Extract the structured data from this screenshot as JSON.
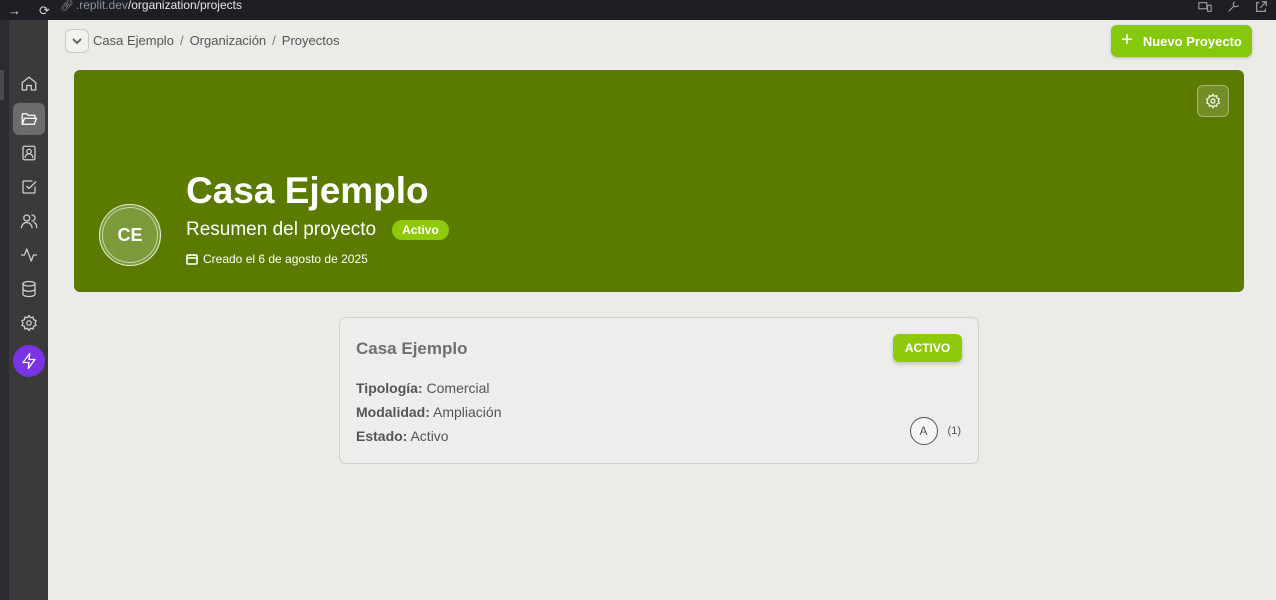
{
  "browser": {
    "url_host": ".replit.dev",
    "url_path": "/organization/projects"
  },
  "sidebar": {
    "items": [
      {
        "name": "home",
        "icon": "home-icon"
      },
      {
        "name": "projects",
        "icon": "folder-open-icon",
        "active": true
      },
      {
        "name": "contacts",
        "icon": "contact-icon"
      },
      {
        "name": "tasks",
        "icon": "check-square-icon"
      },
      {
        "name": "users",
        "icon": "users-icon"
      },
      {
        "name": "activity",
        "icon": "activity-icon"
      },
      {
        "name": "database",
        "icon": "database-icon"
      },
      {
        "name": "settings",
        "icon": "gear-icon"
      },
      {
        "name": "boost",
        "icon": "lightning-icon"
      }
    ]
  },
  "breadcrumb": [
    "Casa Ejemplo",
    "Organización",
    "Proyectos"
  ],
  "topbar": {
    "new_project_label": "Nuevo Proyecto"
  },
  "hero": {
    "initials": "CE",
    "title": "Casa Ejemplo",
    "subtitle": "Resumen del proyecto",
    "status": "Activo",
    "created": "Creado el 6 de agosto de 2025"
  },
  "card": {
    "title": "Casa Ejemplo",
    "status": "ACTIVO",
    "rows": [
      {
        "label": "Tipología:",
        "value": "Comercial"
      },
      {
        "label": "Modalidad:",
        "value": "Ampliación"
      },
      {
        "label": "Estado:",
        "value": "Activo"
      }
    ],
    "user_initial": "A",
    "user_count": "(1)"
  },
  "colors": {
    "brand_green": "#5b7b00",
    "accent_green": "#86c80e",
    "bolt_purple": "#7b33e6"
  }
}
